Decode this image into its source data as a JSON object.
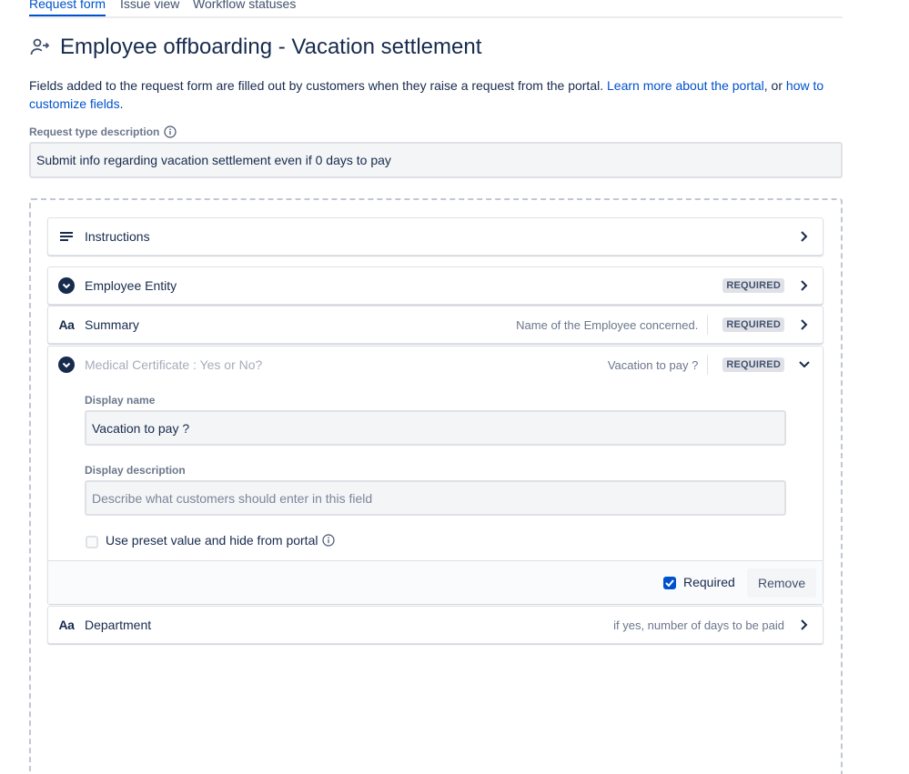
{
  "tabs": [
    {
      "label": "Request form",
      "active": true
    },
    {
      "label": "Issue view"
    },
    {
      "label": "Workflow statuses"
    }
  ],
  "header": {
    "icon": "person-arrow-icon",
    "title": "Employee offboarding - Vacation settlement"
  },
  "intro": {
    "text": "Fields added to the request form are filled out by customers when they raise a request from the portal. ",
    "link1": "Learn more about the portal",
    "between": ", or ",
    "link2": "how to customize fields",
    "end": "."
  },
  "request_type": {
    "label": "Request type description",
    "value": "Submit info regarding vacation settlement even if 0 days to pay"
  },
  "fields": {
    "instructions": {
      "label": "Instructions",
      "icon": "lines-icon"
    },
    "employee_entity": {
      "label": "Employee Entity",
      "badge": "REQUIRED",
      "icon": "dropdown-circle-icon"
    },
    "summary": {
      "label": "Summary",
      "icon_text": "Aa",
      "hint": "Name of the Employee concerned.",
      "badge": "REQUIRED"
    },
    "medical": {
      "label": "Medical Certificate : Yes or No?",
      "hint": "Vacation to pay ?",
      "badge": "REQUIRED",
      "display_name_label": "Display name",
      "display_name_value": "Vacation to pay ?",
      "display_description_label": "Display description",
      "display_description_placeholder": "Describe what customers should enter in this field",
      "preset_label": "Use preset value and hide from portal",
      "required_label": "Required",
      "remove_label": "Remove"
    },
    "department": {
      "label": "Department",
      "icon_text": "Aa",
      "hint": "if yes, number of days to be paid"
    }
  },
  "colors": {
    "accent": "#0052cc",
    "text": "#172b4d",
    "muted": "#6b778c",
    "border": "#dfe1e6"
  }
}
